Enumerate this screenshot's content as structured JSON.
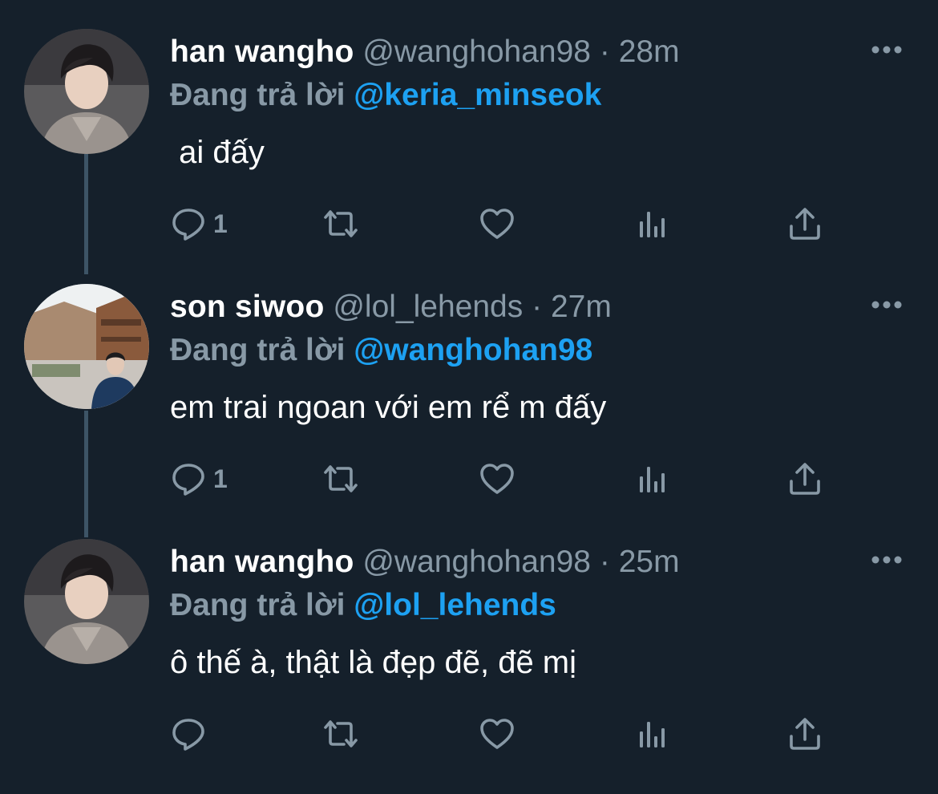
{
  "colors": {
    "background": "#15202b",
    "text_primary": "#ffffff",
    "text_secondary": "#8899a6",
    "accent": "#1da1f2",
    "thread_line": "#3d5466"
  },
  "tweets": [
    {
      "name": "han wangho",
      "handle": "@wanghohan98",
      "separator": "·",
      "time": "28m",
      "reply_prefix": "Đang trả lời",
      "reply_to": "@keria_minseok",
      "text": " ai đấy",
      "reply_count": "1",
      "avatar_icon": "profile-photo"
    },
    {
      "name": "son siwoo",
      "handle": "@lol_lehends",
      "separator": "·",
      "time": "27m",
      "reply_prefix": "Đang trả lời",
      "reply_to": "@wanghohan98",
      "text": "em trai ngoan với em rể m đấy",
      "reply_count": "1",
      "avatar_icon": "profile-photo"
    },
    {
      "name": "han wangho",
      "handle": "@wanghohan98",
      "separator": "·",
      "time": "25m",
      "reply_prefix": "Đang trả lời",
      "reply_to": "@lol_lehends",
      "text": "ô thế à, thật là đẹp đẽ, đẽ mị",
      "reply_count": "",
      "avatar_icon": "profile-photo"
    }
  ],
  "icons": {
    "reply": "reply-icon",
    "retweet": "retweet-icon",
    "like": "heart-icon",
    "stats": "stats-icon",
    "share": "share-icon",
    "more": "more-icon"
  }
}
